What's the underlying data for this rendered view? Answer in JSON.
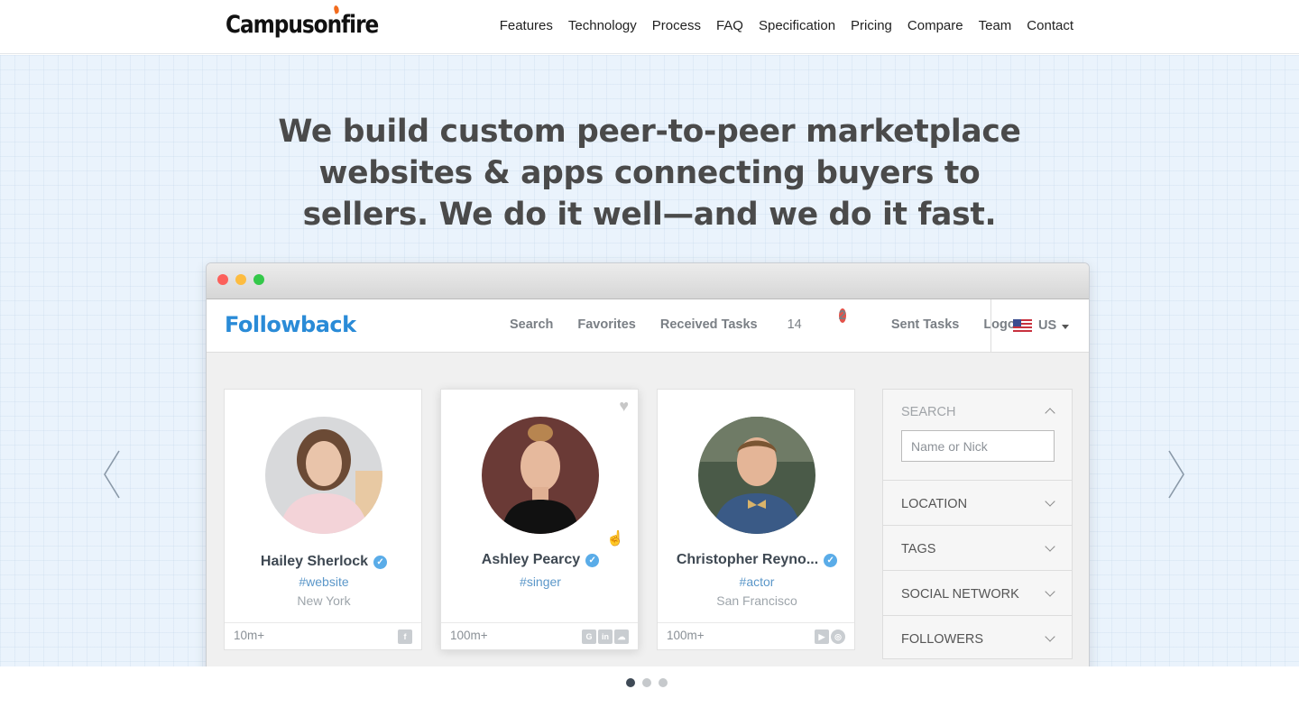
{
  "site": {
    "logo": "Campusonfire",
    "nav": [
      "Features",
      "Technology",
      "Process",
      "FAQ",
      "Specification",
      "Pricing",
      "Compare",
      "Team",
      "Contact"
    ]
  },
  "hero": {
    "headline": "We build custom peer-to-peer marketplace websites & apps connecting buyers to sellers. We do it well—and we do it fast."
  },
  "app": {
    "logo": "Followback",
    "nav": {
      "search": "Search",
      "favorites": "Favorites",
      "received_tasks": "Received Tasks",
      "received_count": "14",
      "received_badge": "2",
      "sent_tasks": "Sent Tasks",
      "logout": "Logout"
    },
    "language": "US",
    "cards": [
      {
        "name": "Hailey Sherlock",
        "tag": "#website",
        "city": "New York",
        "followers": "10m+",
        "socials": [
          "facebook-icon"
        ]
      },
      {
        "name": "Ashley Pearcy",
        "tag": "#singer",
        "city": "",
        "followers": "100m+",
        "socials": [
          "google-plus-icon",
          "linkedin-icon",
          "soundcloud-icon"
        ]
      },
      {
        "name": "Christopher Reyno...",
        "tag": "#actor",
        "city": "San Francisco",
        "followers": "100m+",
        "socials": [
          "youtube-icon",
          "compass-icon"
        ]
      }
    ],
    "filters": {
      "search_label": "SEARCH",
      "search_placeholder": "Name or Nick",
      "location": "LOCATION",
      "tags": "TAGS",
      "social_network": "SOCIAL NETWORK",
      "followers": "FOLLOWERS"
    }
  },
  "carousel": {
    "slides": 3,
    "active": 1
  },
  "colors": {
    "brand": "#2a8bd7",
    "hero_bg": "#eaf3fc",
    "badge": "#e2534b",
    "verified": "#5aace8"
  }
}
